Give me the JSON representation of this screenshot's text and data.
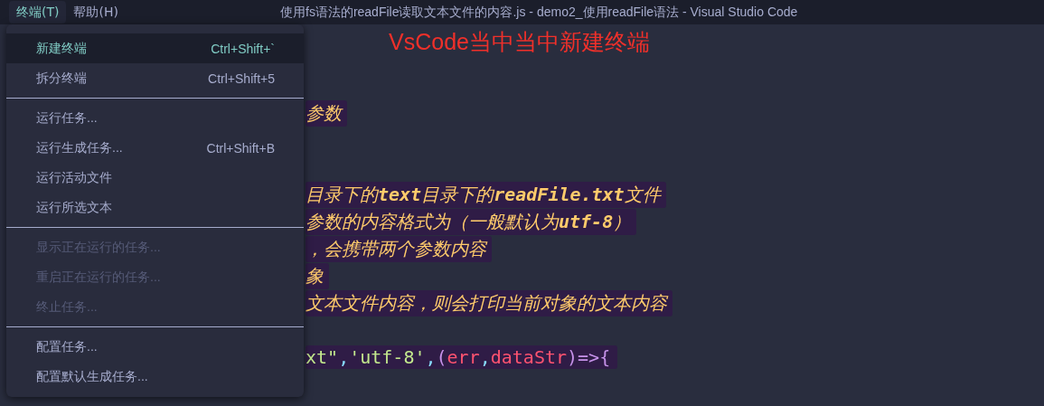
{
  "menubar": [
    {
      "label": "终端(T)",
      "selected": true
    },
    {
      "label": "帮助(H)",
      "selected": false
    }
  ],
  "window": {
    "title": "使用fs语法的readFile读取文本文件的内容.js - demo2_使用readFile语法 - Visual Studio Code"
  },
  "annotation": "VsCode当中当中新建终端",
  "editor": {
    "lines": [
      {
        "kind": "comment",
        "text": "参数"
      },
      {
        "kind": "blank"
      },
      {
        "kind": "blank"
      },
      {
        "kind": "comment",
        "text": "目录下的**text**目录下的**readFile.txt**文件"
      },
      {
        "kind": "comment",
        "text": "参数的内容格式为（一般默认为**utf-8**）"
      },
      {
        "kind": "comment",
        "text": "，会携带两个参数内容"
      },
      {
        "kind": "comment",
        "text": "象"
      },
      {
        "kind": "comment",
        "text": "文本文件内容，则会打印当前对象的文本内容"
      },
      {
        "kind": "blank"
      },
      {
        "kind": "code",
        "tokens": [
          {
            "color": "#c3e88d",
            "text": "xt\""
          },
          {
            "color": "#89ddff",
            "text": ","
          },
          {
            "color": "#c3e88d",
            "text": "'utf-8'"
          },
          {
            "color": "#89ddff",
            "text": ","
          },
          {
            "color": "#c792ea",
            "text": "("
          },
          {
            "color": "#ff5370",
            "text": "err"
          },
          {
            "color": "#89ddff",
            "text": ","
          },
          {
            "color": "#ff5370",
            "text": "dataStr"
          },
          {
            "color": "#c792ea",
            "text": ")"
          },
          {
            "color": "#c792ea",
            "text": "=>"
          },
          {
            "color": "#c792ea",
            "text": "{"
          }
        ]
      }
    ]
  },
  "menu": {
    "groups": [
      [
        {
          "label": "新建终端",
          "shortcut": "Ctrl+Shift+`",
          "selected": true,
          "disabled": false
        },
        {
          "label": "拆分终端",
          "shortcut": "Ctrl+Shift+5",
          "selected": false,
          "disabled": false
        }
      ],
      [
        {
          "label": "运行任务...",
          "selected": false,
          "disabled": false
        },
        {
          "label": "运行生成任务...",
          "shortcut": "Ctrl+Shift+B",
          "selected": false,
          "disabled": false
        },
        {
          "label": "运行活动文件",
          "selected": false,
          "disabled": false
        },
        {
          "label": "运行所选文本",
          "selected": false,
          "disabled": false
        }
      ],
      [
        {
          "label": "显示正在运行的任务...",
          "selected": false,
          "disabled": true
        },
        {
          "label": "重启正在运行的任务...",
          "selected": false,
          "disabled": true
        },
        {
          "label": "终止任务...",
          "selected": false,
          "disabled": true
        }
      ],
      [
        {
          "label": "配置任务...",
          "selected": false,
          "disabled": false
        },
        {
          "label": "配置默认生成任务...",
          "selected": false,
          "disabled": false
        }
      ]
    ]
  }
}
